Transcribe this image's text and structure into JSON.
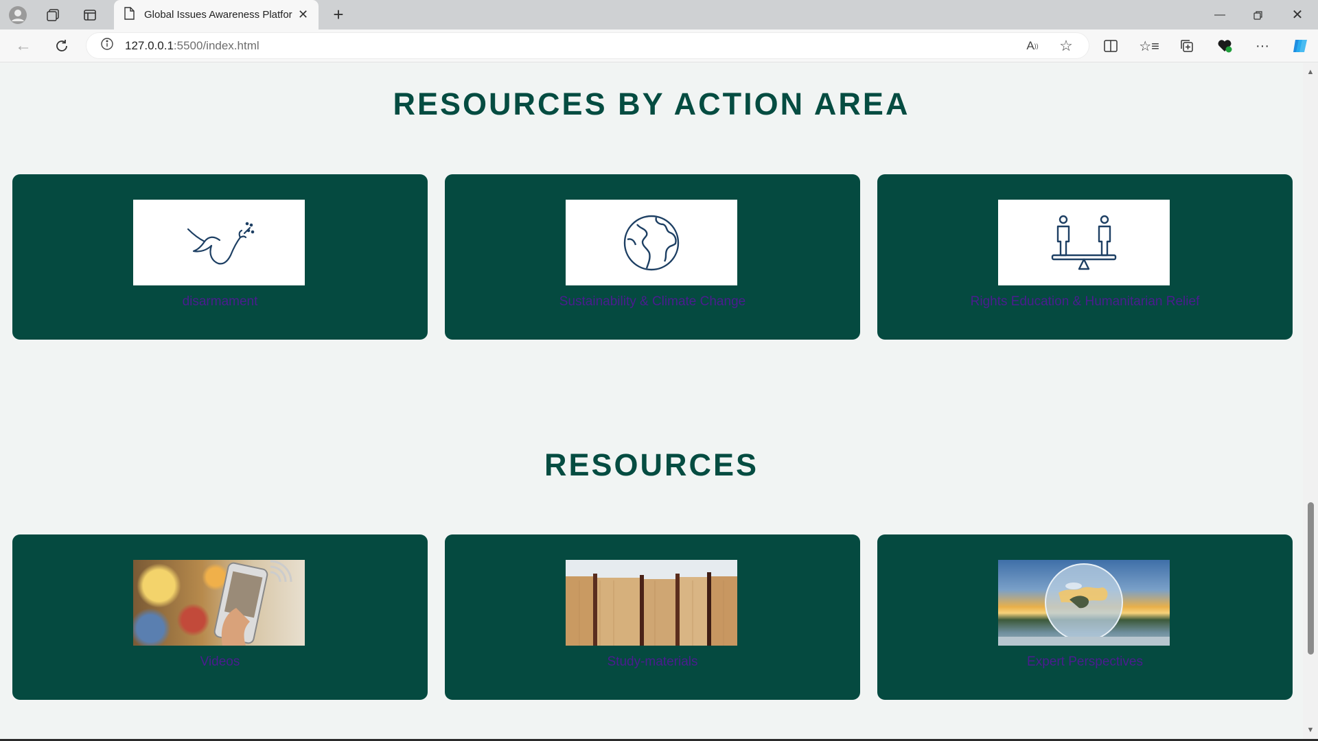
{
  "browser": {
    "tab_title": "Global Issues Awareness Platform",
    "url_host": "127.0.0.1",
    "url_rest": ":5500/index.html"
  },
  "sections": {
    "action_area": {
      "title": "RESOURCES BY ACTION AREA",
      "cards": [
        {
          "label": "disarmament",
          "image": "dove-icon"
        },
        {
          "label": "Sustainability & Climate Change",
          "image": "globe-icon"
        },
        {
          "label": "Rights Education & Humanitarian Relief",
          "image": "balance-people-icon"
        }
      ]
    },
    "resources": {
      "title": "RESOURCES",
      "cards": [
        {
          "label": "Videos",
          "image": "phone-video-photo"
        },
        {
          "label": "Study-materials",
          "image": "books-photo"
        },
        {
          "label": "Expert Perspectives",
          "image": "crystal-globe-photo"
        }
      ]
    }
  },
  "colors": {
    "accent": "#054a40",
    "page_bg": "#f1f4f3",
    "link": "#4b1c8f"
  }
}
